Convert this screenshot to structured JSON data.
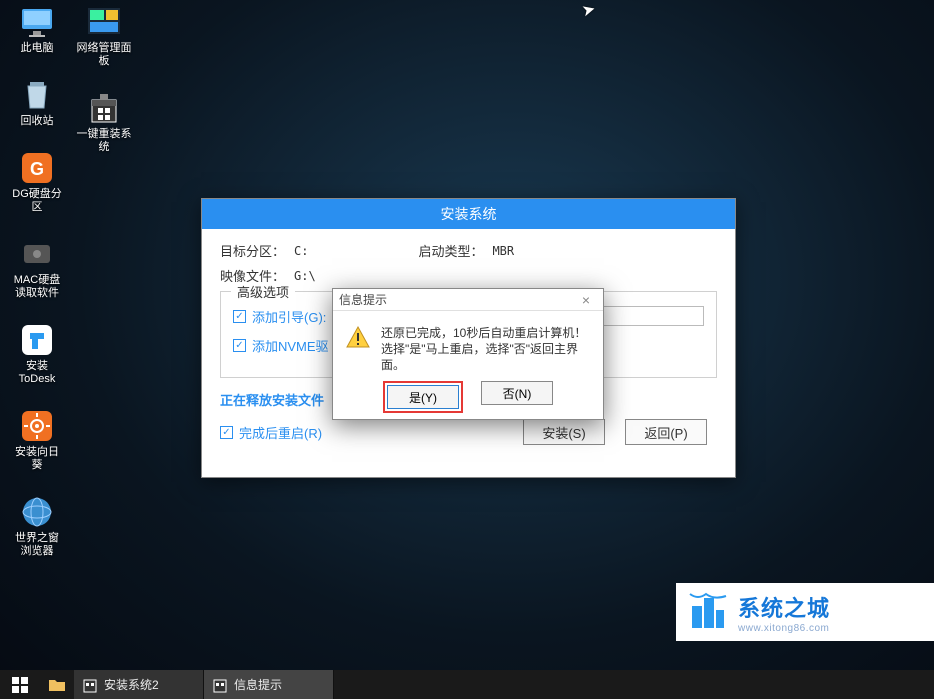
{
  "desktop": {
    "col1": [
      {
        "label": "此电脑"
      },
      {
        "label": "回收站"
      },
      {
        "label": "DG硬盘分区"
      },
      {
        "label": "MAC硬盘读取软件"
      },
      {
        "label": "安装ToDesk"
      },
      {
        "label": "安装向日葵"
      },
      {
        "label": "世界之窗浏览器"
      }
    ],
    "col2": [
      {
        "label": "网络管理面板"
      },
      {
        "label": "一键重装系统"
      }
    ]
  },
  "installer": {
    "title": "安装系统",
    "target_label": "目标分区：",
    "target_value": "C:",
    "boot_label": "启动类型：",
    "boot_value": "MBR",
    "image_label": "映像文件：",
    "image_value": "G:\\",
    "adv_title": "高级选项",
    "chk_boot": "添加引导(G):",
    "chk_nvme": "添加NVME驱",
    "status": "正在释放安装文件",
    "chk_restart": "完成后重启(R)",
    "btn_install": "安装(S)",
    "btn_back": "返回(P)"
  },
  "msgbox": {
    "title": "信息提示",
    "line1": "还原已完成，10秒后自动重启计算机！",
    "line2": "选择\"是\"马上重启，选择\"否\"返回主界面。",
    "btn_yes": "是(Y)",
    "btn_no": "否(N)"
  },
  "brand": {
    "cn": "系统之城",
    "en": "www.xitong86.com"
  },
  "taskbar": {
    "task1": "安装系统2",
    "task2": "信息提示"
  }
}
